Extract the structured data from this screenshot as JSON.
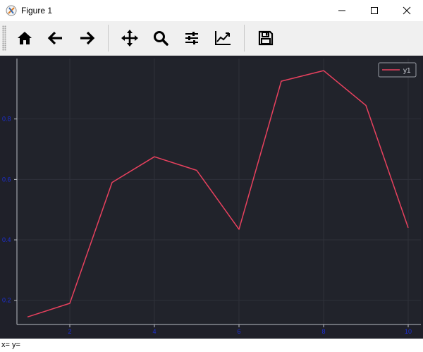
{
  "window": {
    "title": "Figure 1"
  },
  "toolbar": {
    "buttons": [
      {
        "icon": "home-icon",
        "tooltip": "Home"
      },
      {
        "icon": "arrow-left-icon",
        "tooltip": "Back"
      },
      {
        "icon": "arrow-right-icon",
        "tooltip": "Forward"
      },
      {
        "icon": "move-icon",
        "tooltip": "Pan"
      },
      {
        "icon": "search-icon",
        "tooltip": "Zoom"
      },
      {
        "icon": "sliders-icon",
        "tooltip": "Configure subplots"
      },
      {
        "icon": "line-chart-icon",
        "tooltip": "Edit axis"
      },
      {
        "icon": "save-icon",
        "tooltip": "Save"
      }
    ]
  },
  "status": {
    "coords": "x= y="
  },
  "colors": {
    "figure_bg": "#1f2029",
    "axes_bg": "#21232b",
    "line": "#e8415e",
    "tick_label": "#1d2fd6",
    "spine": "#b8bcc4",
    "grid": "#2e313a"
  },
  "chart_data": {
    "type": "line",
    "title": "",
    "xlabel": "",
    "ylabel": "",
    "xlim": [
      0.75,
      10.3
    ],
    "ylim": [
      0.12,
      1.0
    ],
    "xticks": [
      2,
      4,
      6,
      8,
      10
    ],
    "yticks": [
      0.2,
      0.4,
      0.6,
      0.8
    ],
    "xtick_labels": [
      "2",
      "4",
      "6",
      "8",
      "10"
    ],
    "ytick_labels": [
      "0.2",
      "0.4",
      "0.6",
      "0.8"
    ],
    "grid": true,
    "legend": "top-right",
    "series": [
      {
        "name": "y1",
        "x": [
          1,
          2,
          3,
          4,
          5,
          6,
          7,
          8,
          9,
          10
        ],
        "y": [
          0.145,
          0.19,
          0.59,
          0.675,
          0.63,
          0.435,
          0.925,
          0.96,
          0.845,
          0.44
        ]
      }
    ]
  }
}
